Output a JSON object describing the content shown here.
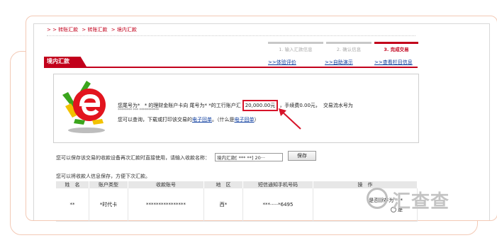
{
  "breadcrumb": [
    "> > 转账汇款",
    "> 转账汇款",
    "> 境内汇款"
  ],
  "steps": [
    "1. 输入汇款信息",
    "2. 确认信息",
    "3. 完成交易"
  ],
  "tab": {
    "title": "境内汇款",
    "links": [
      ">>体验评价",
      ">>自助演示",
      ">>查看栏目信息"
    ]
  },
  "result": {
    "line1_pre": "您尾号为",
    "line1_mid": "的理财金账户卡向 尾号为",
    "line1_post": "的工行账户汇",
    "amount": "20,000.00元",
    "fee_text": "，手续费0.00元，",
    "serial_label": "交易流水号为",
    "serial_mask": "******** *** ***********",
    "line3_text": "您可以查询，下载或打印该交易的",
    "receipt_link": "电子回单",
    "what_is": "。（什么是",
    "what_link": "电子回单",
    "close_paren": "）"
  },
  "save": {
    "text": "您可以保存该交易的收款设备再次汇款时直接使用，请输入收款名称：",
    "input_value": "境内汇款[ *** **] 20···",
    "button": "保存"
  },
  "hint2": "您可以将收款人信息保存，方便下次汇款。",
  "table": {
    "headers": [
      "姓　名",
      "账户类型",
      "收款账号",
      "地　区",
      "短信通知手机号码",
      "操　作"
    ],
    "row": [
      "**",
      "*时代卡",
      "****************",
      "西*",
      "***·····*6495",
      "是否保存为 ***"
    ],
    "radio_label": "是"
  },
  "watermark": "汇查查",
  "colors": {
    "brand": "#c2001b",
    "link": "#0b3b9e",
    "highlight": "#d7142a"
  }
}
